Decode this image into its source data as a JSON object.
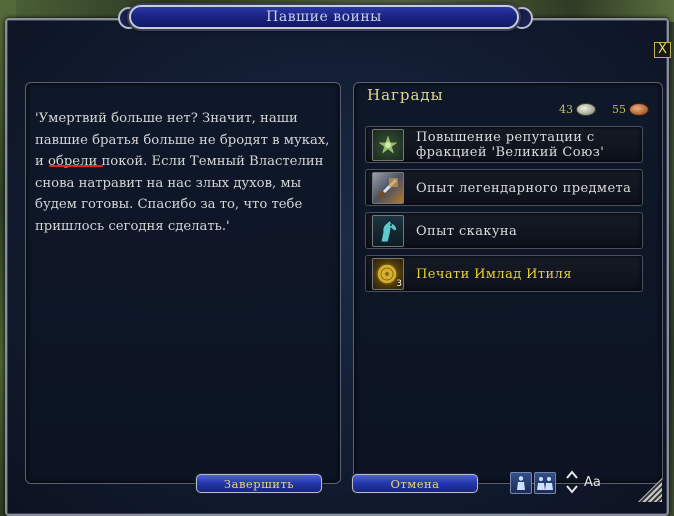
{
  "window": {
    "title": "Павшие воины",
    "close_label": "X"
  },
  "quest": {
    "text": "'Умертвий больше нет? Значит, наши павшие братья больше не бродят в муках, и обрели покой. Если Темный Властелин снова натравит на нас злых духов, мы будем готовы. Спасибо за то, что тебе пришлось сегодня сделать.'"
  },
  "rewards": {
    "title": "Награды",
    "money": {
      "silver": "43",
      "copper": "55"
    },
    "items": [
      {
        "label": "Повышение репутации с фракцией 'Великий Союз'",
        "icon": "reputation-star-icon"
      },
      {
        "label": "Опыт легендарного предмета",
        "icon": "legendary-item-icon"
      },
      {
        "label": "Опыт скакуна",
        "icon": "horse-icon"
      },
      {
        "label": "Печати Имлад Итиля",
        "icon": "seal-coin-icon",
        "quantity": "3"
      }
    ]
  },
  "buttons": {
    "complete": "Завершить",
    "cancel": "Отмена"
  },
  "controls": {
    "font_size_label": "Aa"
  },
  "colors": {
    "title_bar": "#1a2380",
    "button_text": "#e8d870",
    "reward_highlight": "#e8d040",
    "spellcheck_underline": "#e02424"
  }
}
